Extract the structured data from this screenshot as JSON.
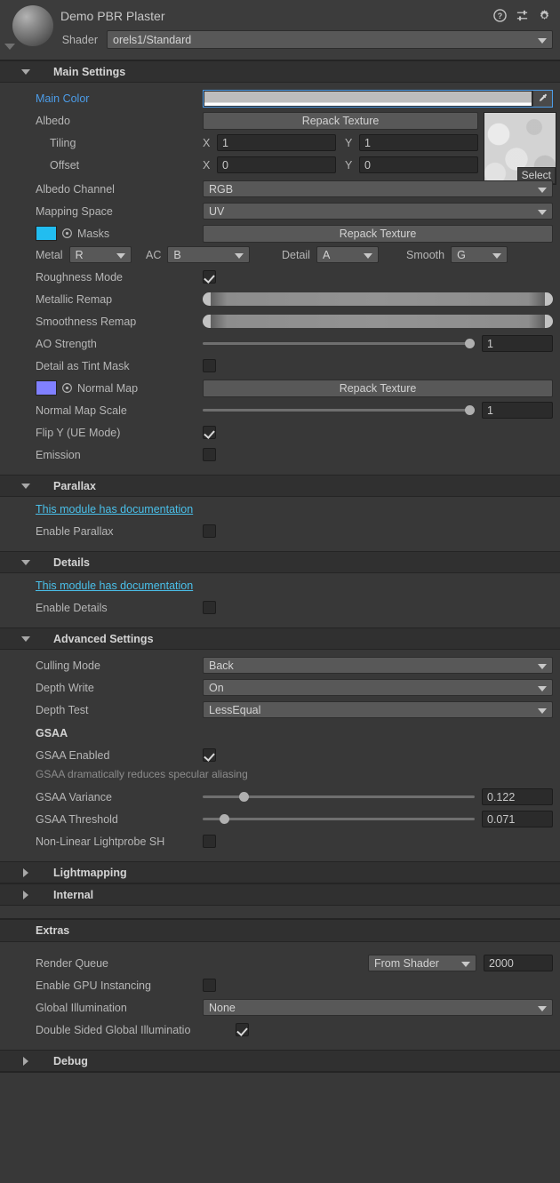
{
  "header": {
    "material_name": "Demo PBR Plaster",
    "shader_label": "Shader",
    "shader_value": "orels1/Standard",
    "icons": [
      "help-icon",
      "preset-icon",
      "gear-icon"
    ]
  },
  "main_settings": {
    "title": "Main Settings",
    "expanded": true,
    "main_color": {
      "label": "Main Color",
      "swatch_hex": "#bdbdbd",
      "alpha_hex": "#ffffff"
    },
    "albedo": {
      "label": "Albedo",
      "button": "Repack Texture",
      "thumb_select": "Select"
    },
    "tiling": {
      "label": "Tiling",
      "x_letter": "X",
      "x": "1",
      "y_letter": "Y",
      "y": "1"
    },
    "offset": {
      "label": "Offset",
      "x_letter": "X",
      "x": "0",
      "y_letter": "Y",
      "y": "0"
    },
    "albedo_channel": {
      "label": "Albedo Channel",
      "value": "RGB"
    },
    "mapping_space": {
      "label": "Mapping Space",
      "value": "UV"
    },
    "masks": {
      "label": "Masks",
      "chip_hex": "#22bdf0",
      "button": "Repack Texture"
    },
    "channels": [
      {
        "label": "Metal",
        "value": "R"
      },
      {
        "label": "AC",
        "value": "B"
      },
      {
        "label": "Detail",
        "value": "A"
      },
      {
        "label": "Smooth",
        "value": "G"
      }
    ],
    "roughness_mode": {
      "label": "Roughness Mode",
      "checked": true
    },
    "metallic_remap": {
      "label": "Metallic Remap",
      "min": 0,
      "max": 1
    },
    "smoothness_remap": {
      "label": "Smoothness Remap",
      "min": 0,
      "max": 1
    },
    "ao_strength": {
      "label": "AO Strength",
      "value": "1",
      "pct": 98
    },
    "detail_tint_mask": {
      "label": "Detail as Tint Mask",
      "checked": false
    },
    "normal_map": {
      "label": "Normal Map",
      "chip_hex": "#8080ff",
      "button": "Repack Texture"
    },
    "normal_map_scale": {
      "label": "Normal Map Scale",
      "value": "1",
      "pct": 98
    },
    "flip_y": {
      "label": "Flip Y (UE Mode)",
      "checked": true
    },
    "emission": {
      "label": "Emission",
      "checked": false
    }
  },
  "parallax": {
    "title": "Parallax",
    "expanded": true,
    "doc_link": "This module has documentation",
    "enable": {
      "label": "Enable Parallax",
      "checked": false
    }
  },
  "details": {
    "title": "Details",
    "expanded": true,
    "doc_link": "This module has documentation",
    "enable": {
      "label": "Enable Details",
      "checked": false
    }
  },
  "advanced": {
    "title": "Advanced Settings",
    "expanded": true,
    "culling_mode": {
      "label": "Culling Mode",
      "value": "Back"
    },
    "depth_write": {
      "label": "Depth Write",
      "value": "On"
    },
    "depth_test": {
      "label": "Depth Test",
      "value": "LessEqual"
    },
    "gsaa_heading": "GSAA",
    "gsaa_enabled": {
      "label": "GSAA Enabled",
      "checked": true
    },
    "gsaa_hint": "GSAA dramatically reduces specular aliasing",
    "gsaa_variance": {
      "label": "GSAA Variance",
      "value": "0.122",
      "pct": 15
    },
    "gsaa_threshold": {
      "label": "GSAA Threshold",
      "value": "0.071",
      "pct": 8
    },
    "non_linear_sh": {
      "label": "Non-Linear Lightprobe SH",
      "checked": false
    }
  },
  "lightmapping": {
    "title": "Lightmapping",
    "expanded": false
  },
  "internal": {
    "title": "Internal",
    "expanded": false
  },
  "extras": {
    "title": "Extras",
    "render_queue": {
      "label": "Render Queue",
      "mode": "From Shader",
      "value": "2000"
    },
    "gpu_instancing": {
      "label": "Enable GPU Instancing",
      "checked": false
    },
    "global_illumination": {
      "label": "Global Illumination",
      "value": "None"
    },
    "double_sided_gi": {
      "label": "Double Sided Global Illuminatio",
      "checked": true
    }
  },
  "debug": {
    "title": "Debug",
    "expanded": false
  }
}
